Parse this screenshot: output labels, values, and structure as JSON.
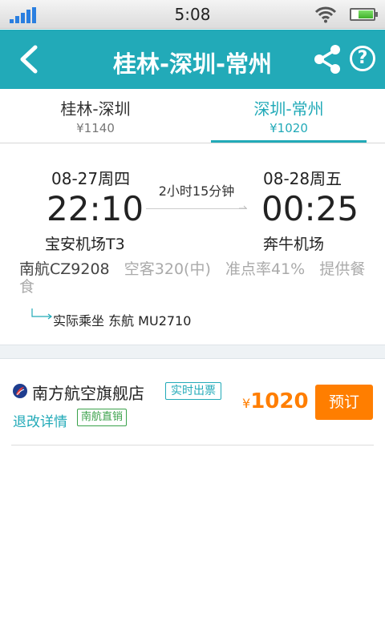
{
  "status_bar": {
    "time": "5:08",
    "icons": [
      "signal-icon",
      "wifi-icon",
      "battery-icon"
    ]
  },
  "header": {
    "title": "桂林-深圳-常州",
    "icons": [
      "back-arrow-icon",
      "share-icon",
      "help-icon"
    ],
    "help_glyph": "?"
  },
  "tabs": [
    {
      "route": "桂林-深圳",
      "price": "¥1140",
      "active": false
    },
    {
      "route": "深圳-常州",
      "price": "¥1020",
      "active": true
    }
  ],
  "flight": {
    "departure": {
      "date": "08-27周四",
      "time": "22:10",
      "airport": "宝安机场T3"
    },
    "arrival": {
      "date": "08-28周五",
      "time": "00:25",
      "airport": "奔牛机场"
    },
    "duration": "2小时15分钟",
    "flight_no": "南航CZ9208",
    "aircraft": "空客320(中)",
    "on_time_rate": "准点率41%",
    "meal": "提供餐食",
    "codeshare": "实际乘坐 东航 MU2710"
  },
  "seller": {
    "name": "南方航空旗舰店",
    "tag_realtime": "实时出票",
    "refund_link": "退改详情",
    "tag_direct": "南航直销",
    "currency": "¥",
    "price": "1020",
    "book_label": "预订"
  },
  "colors": {
    "accent": "#22aab8",
    "price": "#ff7e00",
    "direct_tag": "#3aa14a"
  }
}
